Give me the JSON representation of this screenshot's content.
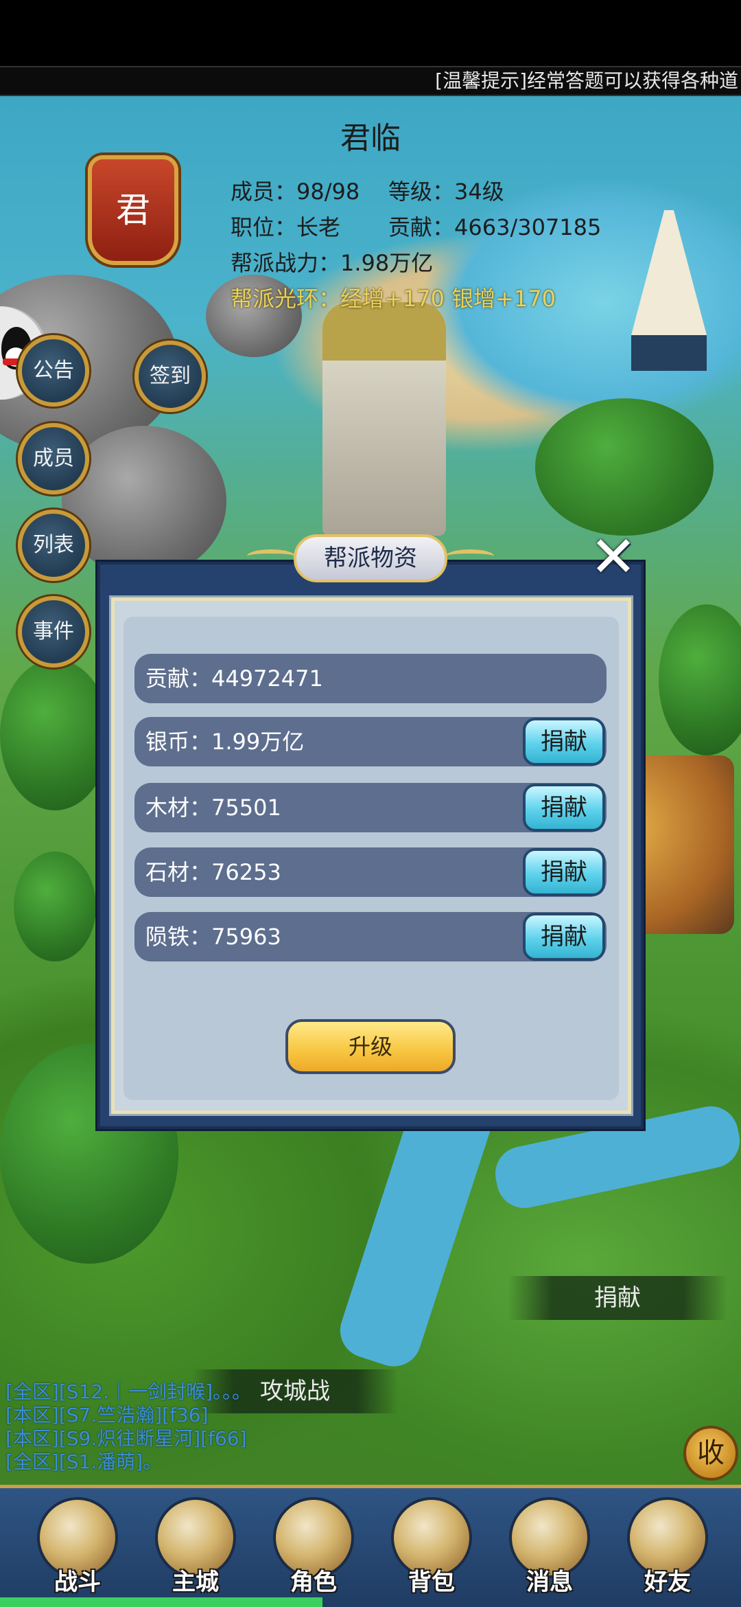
{
  "marquee": "[温馨提示]经常答题可以获得各种道",
  "guild": {
    "name": "君临",
    "emblem": "君",
    "members": "成员：98/98",
    "level": "等级：34级",
    "position": "职位：长老",
    "contribution": "贡献：4663/307185",
    "power": "帮派战力：1.98万亿",
    "aura": "帮派光环：经增+170 银增+170"
  },
  "left_buttons": {
    "notice": "公告",
    "checkin": "签到",
    "members": "成员",
    "list": "列表",
    "events": "事件"
  },
  "modal": {
    "title": "帮派物资",
    "close": "✕",
    "rows": [
      {
        "label": "贡献：44972471"
      },
      {
        "label": "银币：1.99万亿",
        "button": "捐献"
      },
      {
        "label": "木材：75501",
        "button": "捐献"
      },
      {
        "label": "石材：76253",
        "button": "捐献"
      },
      {
        "label": "陨铁：75963",
        "button": "捐献"
      }
    ],
    "upgrade": "升级"
  },
  "map_labels": {
    "donate": "捐献",
    "siege": "攻城战"
  },
  "chat": [
    "[全区][S12.｜一剑封喉]。。。",
    "[本区][S7.竺浩瀚][f36]",
    "[本区][S9.炽往断星河][f66]",
    "[全区][S1.潘萌]。"
  ],
  "collapse": "收",
  "nav": [
    "战斗",
    "主城",
    "角色",
    "背包",
    "消息",
    "好友"
  ],
  "icons": {
    "close": "close-icon",
    "qq": "qq-penguin-icon"
  }
}
